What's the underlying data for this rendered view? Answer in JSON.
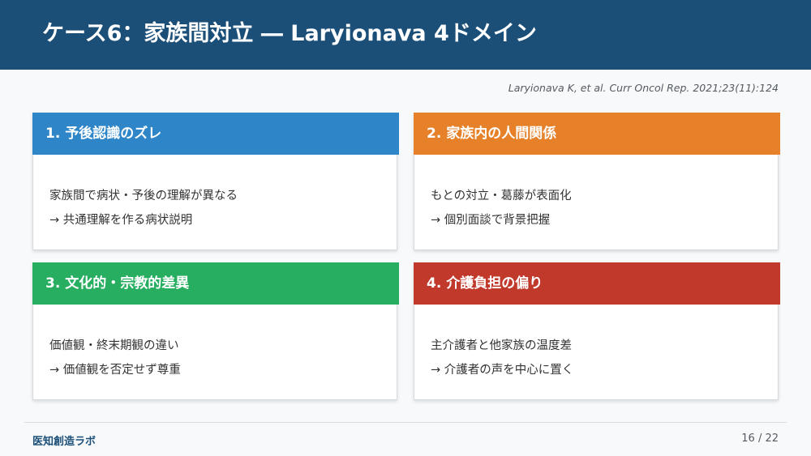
{
  "slide": {
    "title": "ケース6：家族間対立 ― Laryionava 4ドメイン",
    "citation": "Laryionava K, et al. Curr Oncol Rep. 2021;23(11):124"
  },
  "cards": [
    {
      "header": "1. 予後認識のズレ",
      "color": "#2e86c8",
      "line1": "家族間で病状・予後の理解が異なる",
      "line2": "→ 共通理解を作る病状説明"
    },
    {
      "header": "2. 家族内の人間関係",
      "color": "#e6812a",
      "line1": "もとの対立・葛藤が表面化",
      "line2": "→ 個別面談で背景把握"
    },
    {
      "header": "3. 文化的・宗教的差異",
      "color": "#27ae60",
      "line1": "価値観・終末期観の違い",
      "line2": "→ 価値観を否定せず尊重"
    },
    {
      "header": "4. 介護負担の偏り",
      "color": "#c0392b",
      "line1": "主介護者と他家族の温度差",
      "line2": "→ 介護者の声を中心に置く"
    }
  ],
  "footer": {
    "brand": "医知創造ラボ",
    "page": "16 / 22"
  }
}
